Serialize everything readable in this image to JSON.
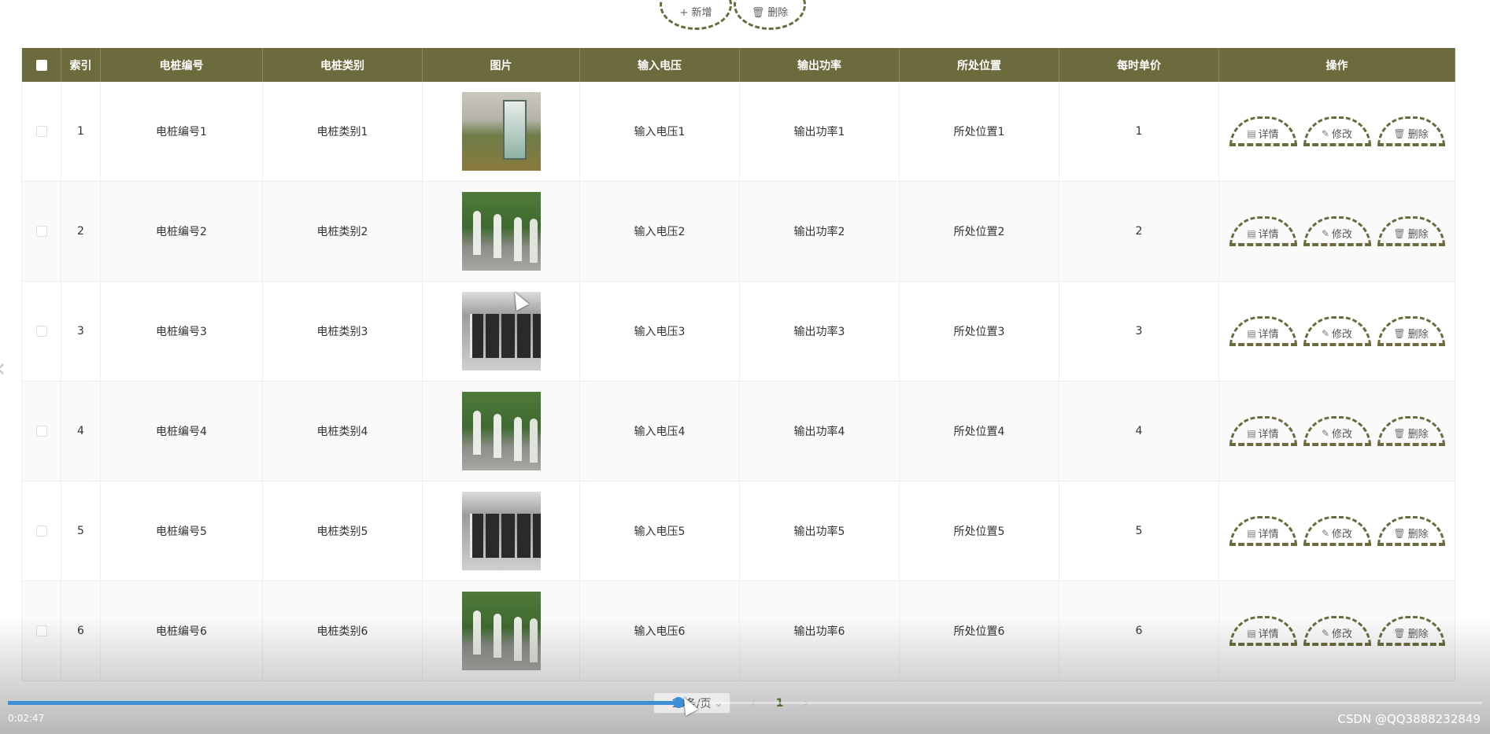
{
  "toolbar": {
    "add_label": "新增",
    "delete_label": "删除",
    "add_icon": "plus-icon",
    "delete_icon": "trash-icon"
  },
  "table": {
    "columns": [
      "索引",
      "电桩编号",
      "电桩类别",
      "图片",
      "输入电压",
      "输出功率",
      "所处位置",
      "每时单价",
      "操作"
    ],
    "rows": [
      {
        "index": "1",
        "code": "电桩编号1",
        "type": "电桩类别1",
        "voltage": "输入电压1",
        "power": "输出功率1",
        "location": "所处位置1",
        "price": "1"
      },
      {
        "index": "2",
        "code": "电桩编号2",
        "type": "电桩类别2",
        "voltage": "输入电压2",
        "power": "输出功率2",
        "location": "所处位置2",
        "price": "2"
      },
      {
        "index": "3",
        "code": "电桩编号3",
        "type": "电桩类别3",
        "voltage": "输入电压3",
        "power": "输出功率3",
        "location": "所处位置3",
        "price": "3"
      },
      {
        "index": "4",
        "code": "电桩编号4",
        "type": "电桩类别4",
        "voltage": "输入电压4",
        "power": "输出功率4",
        "location": "所处位置4",
        "price": "4"
      },
      {
        "index": "5",
        "code": "电桩编号5",
        "type": "电桩类别5",
        "voltage": "输入电压5",
        "power": "输出功率5",
        "location": "所处位置5",
        "price": "5"
      },
      {
        "index": "6",
        "code": "电桩编号6",
        "type": "电桩类别6",
        "voltage": "输入电压6",
        "power": "输出功率6",
        "location": "所处位置6",
        "price": "6"
      }
    ],
    "actions": {
      "detail": "详情",
      "edit": "修改",
      "delete": "删除"
    }
  },
  "pagination": {
    "page_size": "10条/页",
    "current_page": "1"
  },
  "video": {
    "elapsed": "0:02:47",
    "progress_percent": 45.5
  },
  "watermark": "CSDN @QQ3888232849",
  "colors": {
    "header_bg": "#6b6b3d",
    "accent_dash": "#6b6b3d",
    "progress": "#3d8fd6"
  }
}
